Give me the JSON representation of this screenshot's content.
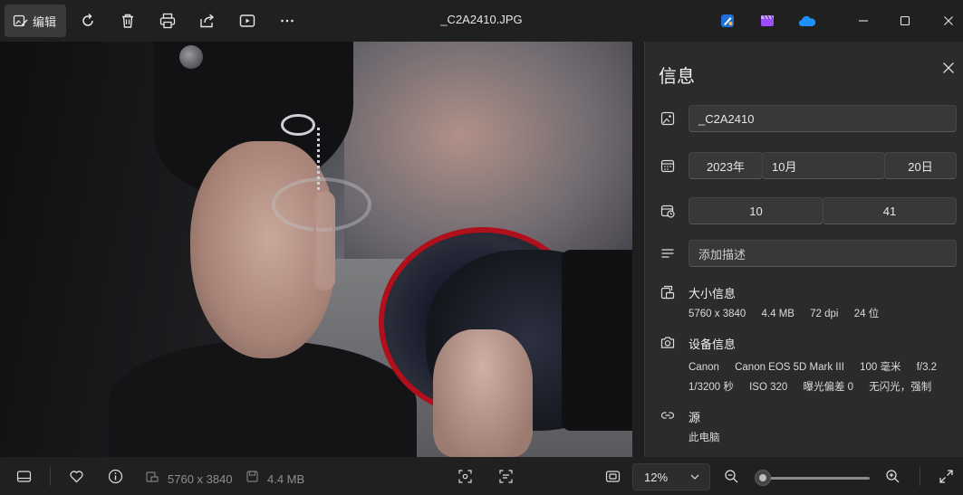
{
  "titlebar": {
    "edit_label": "编辑",
    "filename": "_C2A2410.JPG"
  },
  "panel": {
    "title": "信息",
    "name_value": "_C2A2410",
    "date": {
      "year": "2023年",
      "month": "10月",
      "day": "20日"
    },
    "time": {
      "hour": "10",
      "minute": "41"
    },
    "description_placeholder": "添加描述",
    "size": {
      "title": "大小信息",
      "dimensions": "5760 x 3840",
      "filesize": "4.4 MB",
      "dpi": "72 dpi",
      "bitdepth": "24 位"
    },
    "device": {
      "title": "设备信息",
      "make": "Canon",
      "model": "Canon EOS 5D Mark III",
      "focal": "100 毫米",
      "aperture": "f/3.2",
      "shutter": "1/3200 秒",
      "iso": "ISO 320",
      "exposure": "曝光偏差 0",
      "flash": "无闪光，强制"
    },
    "source": {
      "title": "源",
      "value": "此电脑"
    }
  },
  "bottombar": {
    "dimensions": "5760 x 3840",
    "filesize": "4.4 MB",
    "zoom": "12%",
    "zoom_level": 0.05
  },
  "colors": {
    "background": "#1f1f1f",
    "panel": "#2b2b2b",
    "accent_cloud": "#1e90ff",
    "accent_clipchamp": "#9b4dff"
  }
}
